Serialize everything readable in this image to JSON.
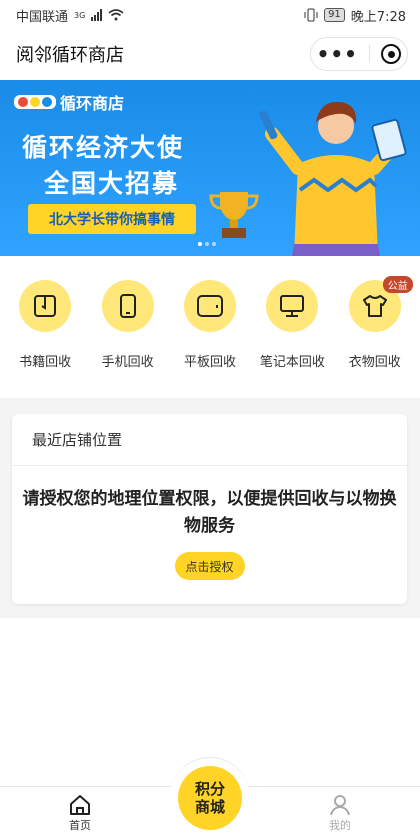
{
  "status_bar": {
    "carrier": "中国联通",
    "network": "3G",
    "battery": "91",
    "time": "晚上7:28"
  },
  "nav": {
    "title": "阅邻循环商店"
  },
  "banner": {
    "logo_text": "循环商店",
    "line1": "循环经济大使",
    "line2": "全国大招募",
    "tag": "北大学长带你搞事情"
  },
  "categories": [
    {
      "label": "书籍回收",
      "icon": "book-icon"
    },
    {
      "label": "手机回收",
      "icon": "phone-icon"
    },
    {
      "label": "平板回收",
      "icon": "tablet-icon"
    },
    {
      "label": "笔记本回收",
      "icon": "laptop-icon"
    },
    {
      "label": "衣物回收",
      "icon": "tshirt-icon",
      "badge": "公益"
    }
  ],
  "store_card": {
    "title": "最近店铺位置",
    "message": "请授权您的地理位置权限，以便提供回收与以物换物服务",
    "button": "点击授权"
  },
  "tabbar": {
    "home": "首页",
    "center_line1": "积分",
    "center_line2": "商城",
    "mine": "我的"
  },
  "colors": {
    "accent_yellow": "#ffd426",
    "icon_bg": "#ffe77a",
    "banner_blue": "#1a8ce8",
    "badge_red": "#c6472c"
  }
}
